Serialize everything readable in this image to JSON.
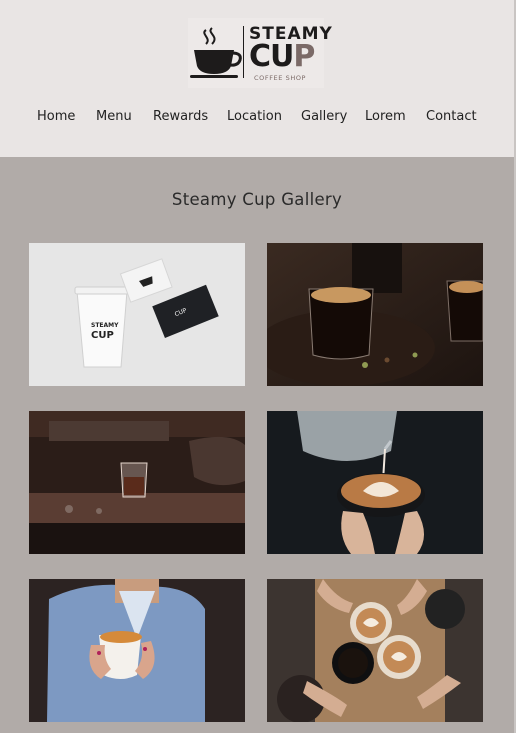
{
  "brand": {
    "name_line1": "STEAMY",
    "name_line2_a": "CU",
    "name_line2_b": "P",
    "tagline": "COFFEE SHOP"
  },
  "nav": {
    "items": [
      "Home",
      "Menu",
      "Rewards",
      "Location",
      "Gallery",
      "Lorem",
      "Contact"
    ]
  },
  "gallery": {
    "title": "Steamy Cup Gallery",
    "images": [
      {
        "label": "branded-cup-mockup"
      },
      {
        "label": "espresso-glasses"
      },
      {
        "label": "espresso-machine"
      },
      {
        "label": "latte-art-pour"
      },
      {
        "label": "woman-holding-coffee"
      },
      {
        "label": "cheers-coffee-cups"
      }
    ],
    "mockup_text": {
      "a": "STEAMY",
      "b": "CUP"
    }
  },
  "colors": {
    "header_bg": "#e9e5e4",
    "main_bg": "#b1aba8",
    "brand_dark": "#1d1b1b",
    "brand_accent": "#7b6a67"
  }
}
